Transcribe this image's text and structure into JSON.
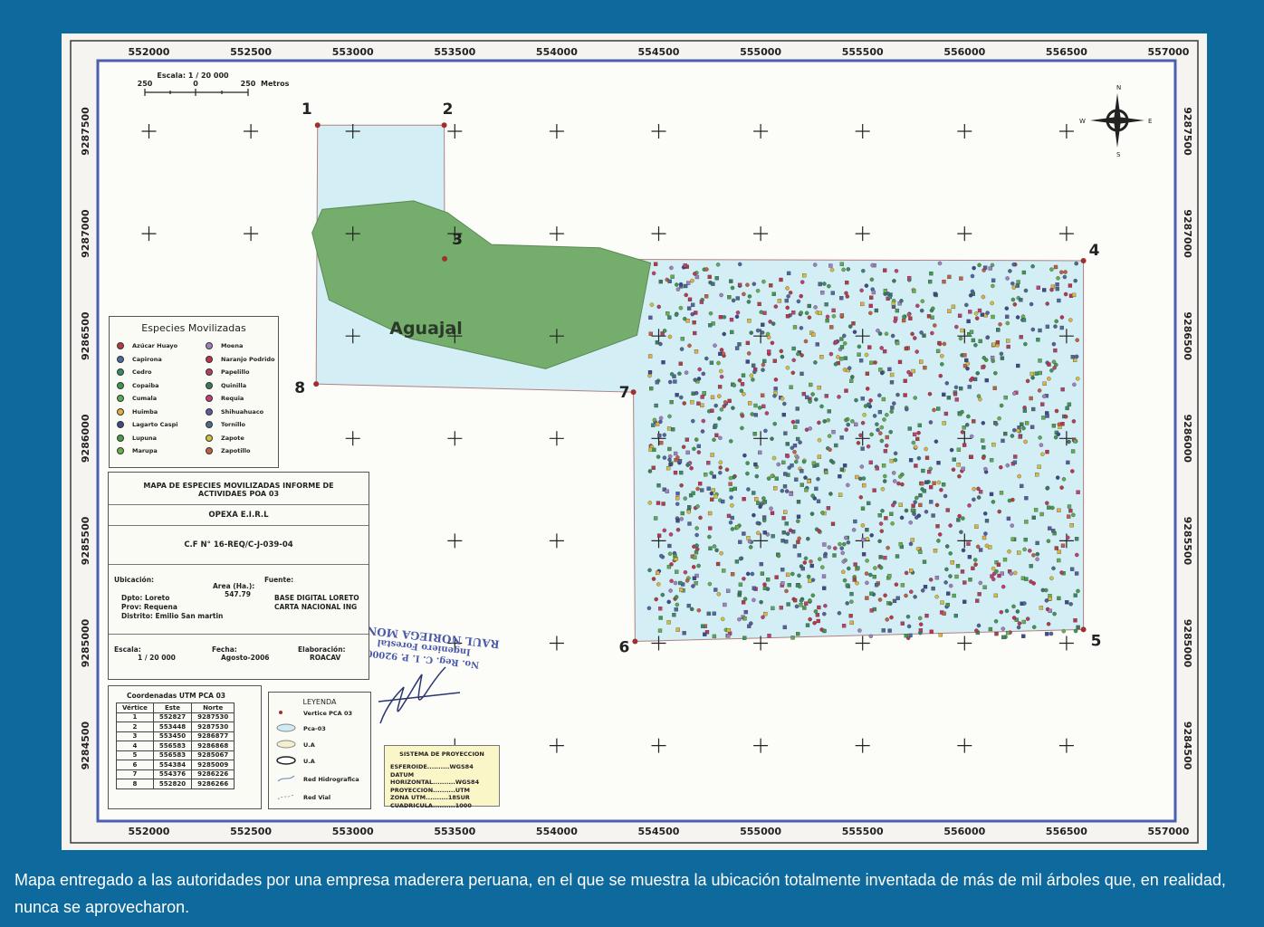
{
  "map": {
    "axis_top": [
      "552000",
      "552500",
      "553000",
      "553500",
      "554000",
      "554500",
      "555000",
      "555500",
      "556000",
      "556500",
      "557000"
    ],
    "axis_bottom": [
      "552000",
      "552500",
      "553000",
      "553500",
      "554000",
      "554500",
      "555000",
      "555500",
      "556000",
      "556500",
      "557000"
    ],
    "axis_left": [
      "9287500",
      "9287000",
      "9286500",
      "9286000",
      "9285500",
      "9285000",
      "9284500"
    ],
    "axis_right": [
      "9287500",
      "9287000",
      "9286500",
      "9286000",
      "9285500",
      "9285000",
      "9284500"
    ],
    "scale_label": "Escala: 1 / 20 000",
    "scale_ticks": [
      "250",
      "0",
      "250"
    ],
    "scale_unit": "Metros",
    "aguajal_label": "Aguajal",
    "compass": {
      "n": "N",
      "s": "S",
      "e": "E",
      "w": "W"
    },
    "vertices": [
      {
        "label": "1",
        "este": 552827,
        "norte": 9287530
      },
      {
        "label": "2",
        "este": 553448,
        "norte": 9287530
      },
      {
        "label": "3",
        "este": 553450,
        "norte": 9286877
      },
      {
        "label": "4",
        "este": 556583,
        "norte": 9286868
      },
      {
        "label": "5",
        "este": 556583,
        "norte": 9285067
      },
      {
        "label": "6",
        "este": 554384,
        "norte": 9285009
      },
      {
        "label": "7",
        "este": 554376,
        "norte": 9286226
      },
      {
        "label": "8",
        "este": 552820,
        "norte": 9286266
      }
    ],
    "colors": {
      "pca": "#d4eef6",
      "aguajal": "#74ad6c",
      "vertex": "#a03030",
      "border": "#4a5fb0",
      "ocean": "#0e6a9c"
    }
  },
  "species_legend": {
    "title": "Especies Movilizadas",
    "left": [
      {
        "name": "Azúcar Huayo",
        "color": "#b04040"
      },
      {
        "name": "Capirona",
        "color": "#4a6aa0"
      },
      {
        "name": "Cedro",
        "color": "#3a8a6a"
      },
      {
        "name": "Copaiba",
        "color": "#3a9a50"
      },
      {
        "name": "Cumala",
        "color": "#5aaa5a"
      },
      {
        "name": "Huimba",
        "color": "#e0b040"
      },
      {
        "name": "Lagarto Caspi",
        "color": "#3a4a8a"
      },
      {
        "name": "Lupuna",
        "color": "#4a9a4a"
      },
      {
        "name": "Marupa",
        "color": "#6ab04a"
      }
    ],
    "right": [
      {
        "name": "Moena",
        "color": "#a080c0"
      },
      {
        "name": "Naranjo Podrido",
        "color": "#c03050"
      },
      {
        "name": "Papelillo",
        "color": "#b04060"
      },
      {
        "name": "Quinilla",
        "color": "#3a7a5a"
      },
      {
        "name": "Requia",
        "color": "#c04070"
      },
      {
        "name": "Shihuahuaco",
        "color": "#5a5aa0"
      },
      {
        "name": "Tornillo",
        "color": "#4a6a8a"
      },
      {
        "name": "Zapote",
        "color": "#d0c040"
      },
      {
        "name": "Zapotillo",
        "color": "#c06040"
      }
    ]
  },
  "info_box": {
    "title": "MAPA DE ESPECIES MOVILIZADAS INFORME DE ACTIVIDAES POA 03",
    "company": "OPEXA E.I.R.L",
    "contract": "C.F N° 16-REQ/C-J-039-04",
    "ubicacion_label": "Ubicación:",
    "area_label": "Area (Ha.):",
    "area_value": "547.79",
    "fuente_label": "Fuente:",
    "dpto": "Dpto: Loreto",
    "prov": "Prov: Requena",
    "distrito": "Distrito: Emilio San martin",
    "fuente_1": "BASE DIGITAL LORETO",
    "fuente_2": "CARTA NACIONAL ING",
    "escala_label": "Escala:",
    "escala_value": "1 / 20 000",
    "fecha_label": "Fecha:",
    "fecha_value": "Agosto-2006",
    "elab_label": "Elaboración:",
    "elab_value": "ROACAV"
  },
  "coords_table": {
    "title": "Coordenadas UTM PCA 03",
    "headers": [
      "Vértice",
      "Este",
      "Norte"
    ],
    "rows": [
      [
        "1",
        "552827",
        "9287530"
      ],
      [
        "2",
        "553448",
        "9287530"
      ],
      [
        "3",
        "553450",
        "9286877"
      ],
      [
        "4",
        "556583",
        "9286868"
      ],
      [
        "5",
        "556583",
        "9285067"
      ],
      [
        "6",
        "554384",
        "9285009"
      ],
      [
        "7",
        "554376",
        "9286226"
      ],
      [
        "8",
        "552820",
        "9286266"
      ]
    ]
  },
  "leyenda": {
    "title": "LEYENDA",
    "items": [
      "Vertice PCA 03",
      "Pca-03",
      "U.A",
      "U.A",
      "Red Hidrografica",
      "Red Vial"
    ]
  },
  "proyeccion": {
    "title": "SISTEMA DE PROYECCION",
    "rows": [
      [
        "ESFEROIDE",
        "WGS84"
      ],
      [
        "DATUM HORIZONTAL",
        "WGS84"
      ],
      [
        "PROYECCION",
        "UTM"
      ],
      [
        "ZONA UTM",
        "18SUR"
      ],
      [
        "CUADRICULA",
        "1000"
      ]
    ]
  },
  "stamp": {
    "line1": "RAUL NORIEGA MONTE",
    "line2": "Ingeniero Forestal",
    "line3": "No. Reg. C. I. P. 92000"
  },
  "caption": "Mapa entregado a las autoridades por una empresa maderera peruana, en el que se muestra la ubicación totalmente inventada de más de mil árboles que, en realidad, nunca se aprovecharon."
}
